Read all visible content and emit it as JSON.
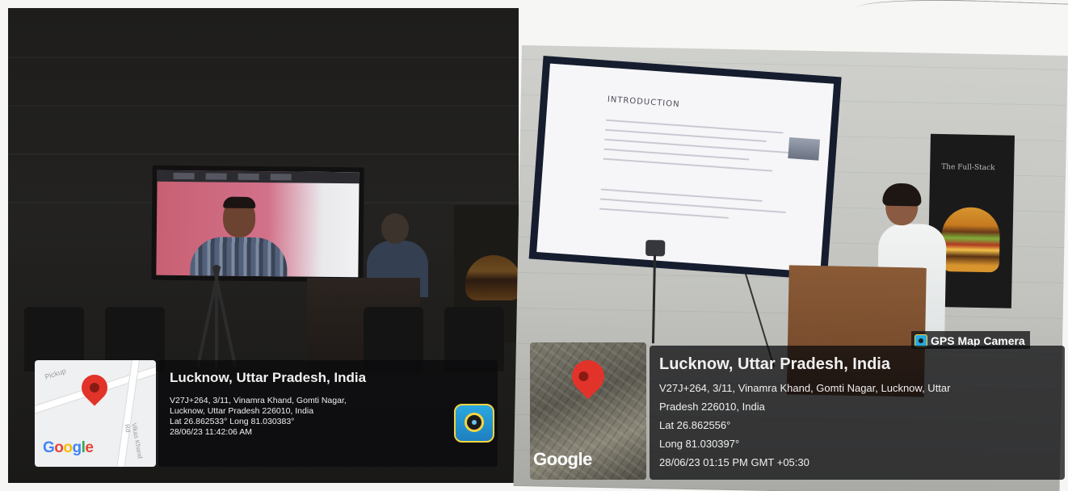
{
  "left_photo": {
    "location": {
      "title": "Lucknow, Uttar Pradesh, India",
      "address_line1": "V27J+264, 3/11, Vinamra Khand, Gomti Nagar,",
      "address_line2": "Lucknow, Uttar Pradesh 226010, India",
      "coords": "Lat 26.862533° Long 81.030383°",
      "timestamp": "28/06/23 11:42:06 AM"
    },
    "map": {
      "provider": "Google",
      "road_label_1": "Pickup",
      "road_label_2": "Vikas Khand Rd",
      "pin_icon": "map-pin-icon"
    },
    "app_icon": "gps-map-camera-icon"
  },
  "right_photo": {
    "badge": {
      "label": "GPS Map Camera",
      "icon": "gps-map-camera-icon"
    },
    "slide": {
      "heading": "INTRODUCTION"
    },
    "poster": {
      "text": "The Full-Stack"
    },
    "location": {
      "title": "Lucknow, Uttar Pradesh, India",
      "address_line1": "V27J+264, 3/11, Vinamra Khand, Gomti Nagar, Lucknow, Uttar",
      "address_line2": "Pradesh 226010, India",
      "lat": "Lat 26.862556°",
      "long": "Long 81.030397°",
      "timestamp": "28/06/23 01:15 PM GMT +05:30"
    },
    "map": {
      "provider": "Google",
      "pin_icon": "map-pin-icon"
    }
  },
  "colors": {
    "pin_red": "#e2332a",
    "overlay_bg": "#0a0a0c",
    "overlay_text": "#f0f0f0"
  }
}
